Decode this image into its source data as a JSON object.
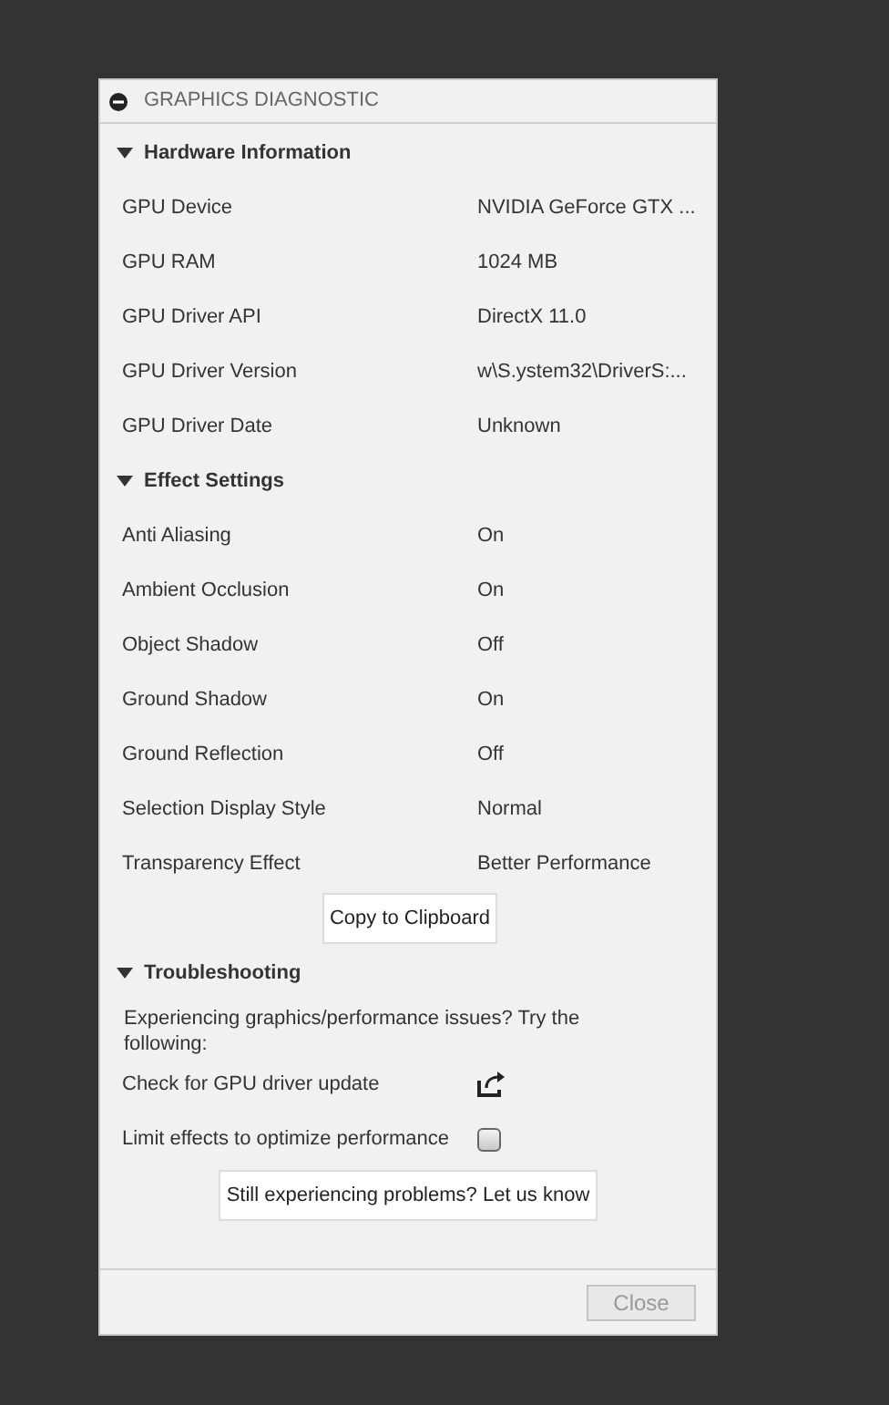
{
  "window": {
    "title": "GRAPHICS DIAGNOSTIC"
  },
  "sections": [
    {
      "title": "Hardware Information",
      "expanded": true,
      "rows": [
        {
          "label": "GPU Device",
          "value": "NVIDIA GeForce GTX ..."
        },
        {
          "label": "GPU RAM",
          "value": "1024 MB"
        },
        {
          "label": "GPU Driver API",
          "value": "DirectX 11.0"
        },
        {
          "label": "GPU Driver Version",
          "value": "w\\S.ystem32\\DriverS:..."
        },
        {
          "label": "GPU Driver Date",
          "value": "Unknown"
        }
      ]
    },
    {
      "title": "Effect Settings",
      "expanded": true,
      "rows": [
        {
          "label": "Anti Aliasing",
          "value": "On"
        },
        {
          "label": "Ambient Occlusion",
          "value": "On"
        },
        {
          "label": "Object Shadow",
          "value": "Off"
        },
        {
          "label": "Ground Shadow",
          "value": "On"
        },
        {
          "label": "Ground Reflection",
          "value": "Off"
        },
        {
          "label": "Selection Display Style",
          "value": "Normal"
        },
        {
          "label": "Transparency Effect",
          "value": "Better Performance"
        }
      ],
      "button": "Copy to Clipboard"
    }
  ],
  "troubleshooting": {
    "title": "Troubleshooting",
    "expanded": true,
    "intro": "Experiencing graphics/performance issues? Try the following:",
    "items": [
      {
        "kind": "link",
        "label": "Check for GPU driver update"
      },
      {
        "kind": "checkbox",
        "label": "Limit effects to optimize performance",
        "checked": false
      }
    ],
    "button": "Still experiencing problems? Let us know"
  },
  "footer": {
    "close": {
      "label": "Close",
      "disabled": true
    }
  }
}
